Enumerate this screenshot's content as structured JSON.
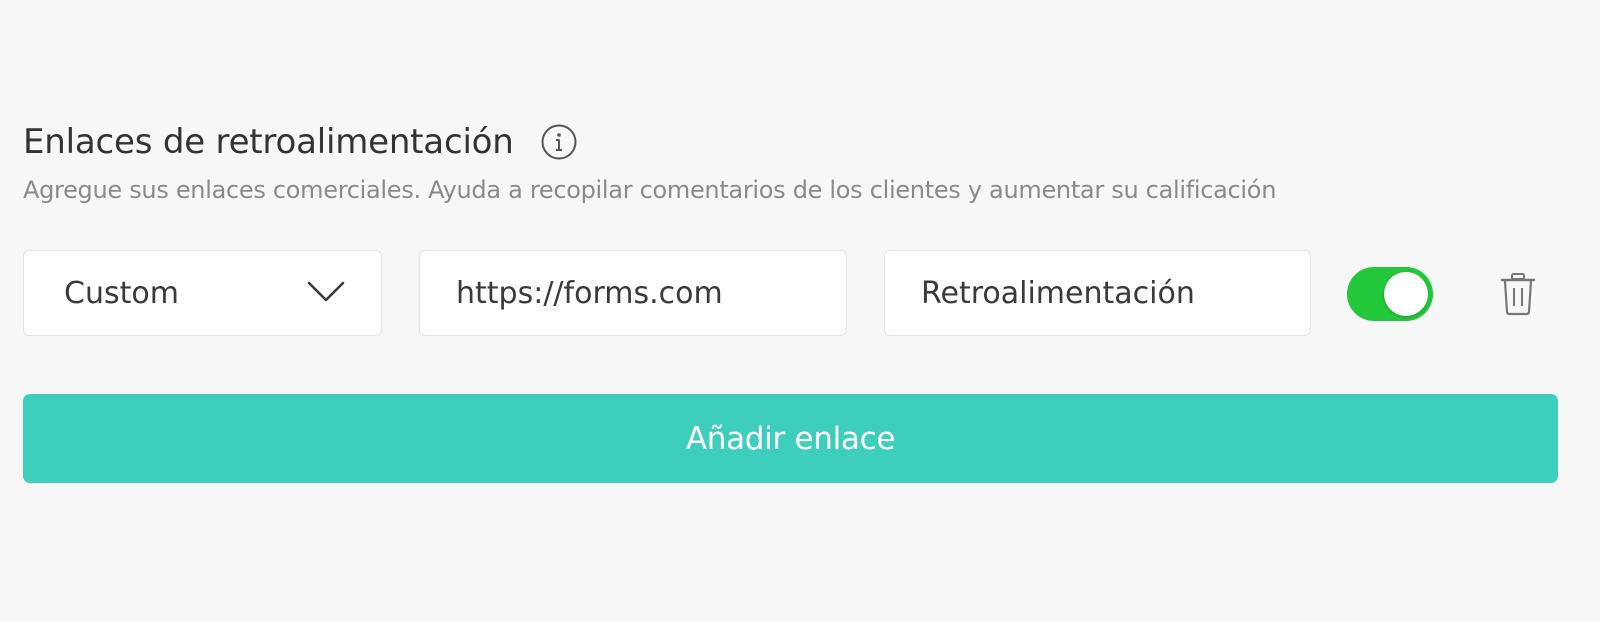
{
  "section": {
    "title": "Enlaces de retroalimentación",
    "subtitle": "Agregue sus enlaces comerciales. Ayuda a recopilar comentarios de los clientes y aumentar su calificación"
  },
  "link_row": {
    "type_select": {
      "value": "Custom",
      "icon": "chevron-down-icon"
    },
    "url_value": "https://forms.com",
    "label_value": "Retroalimentación",
    "enabled": true
  },
  "add_button_label": "Añadir enlace",
  "colors": {
    "background": "#f7f7f7",
    "toggle_on": "#23c93a",
    "button": "#3ecfbc",
    "subtitle": "#8a8a8a"
  }
}
